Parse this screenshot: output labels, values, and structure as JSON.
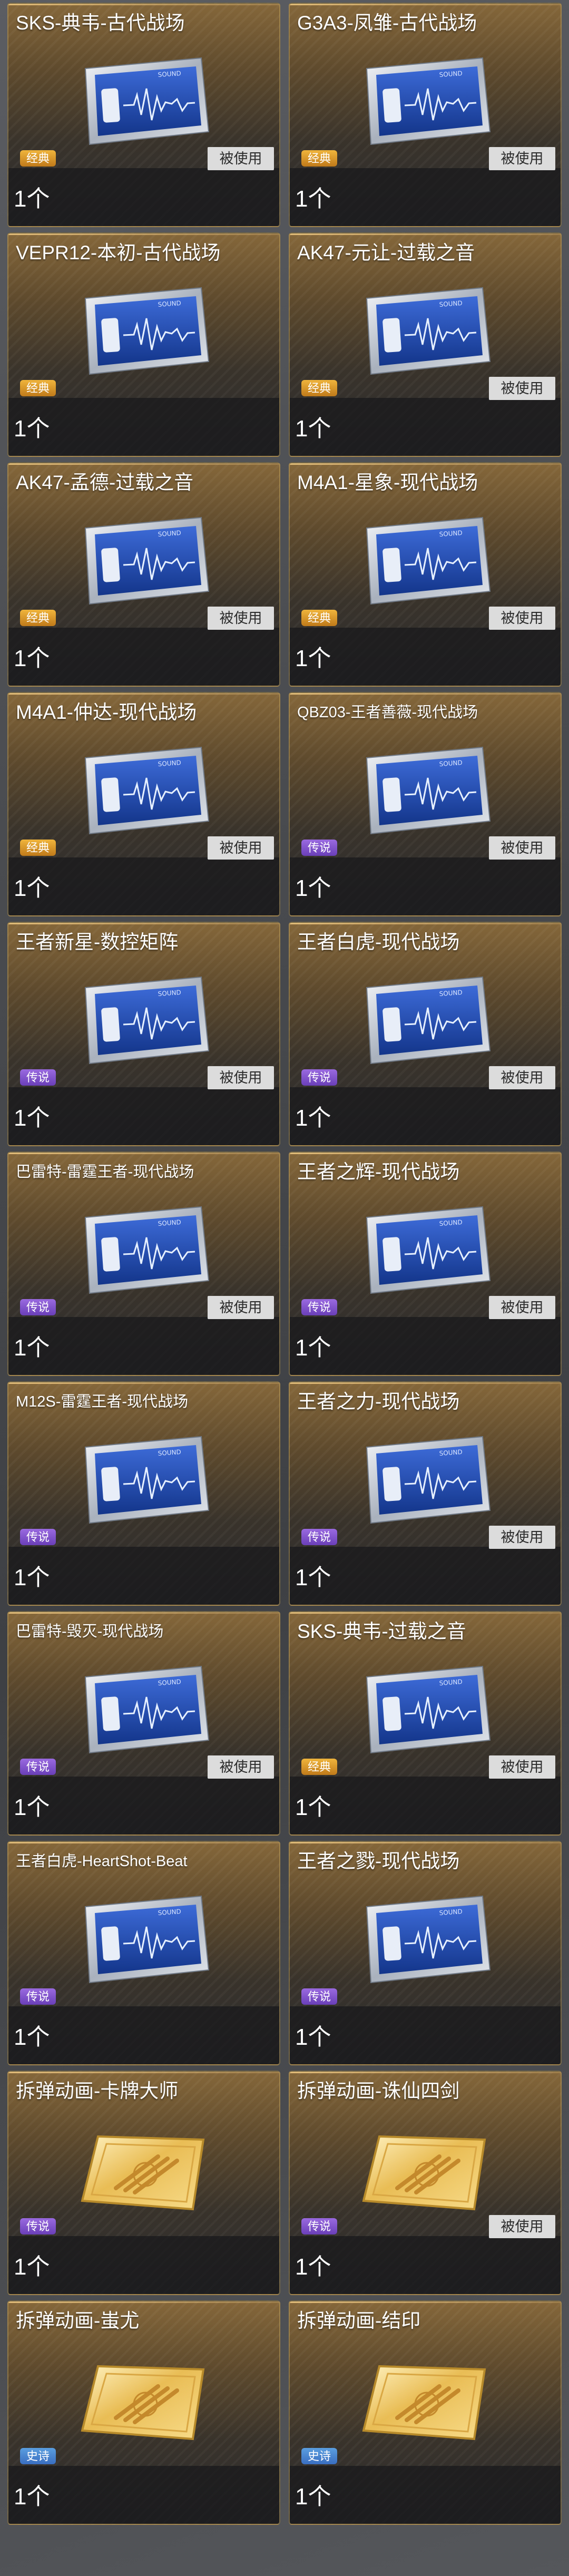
{
  "items": [
    {
      "name": "SKS-典韦-古代战场",
      "rarity": "经典",
      "rarity_class": "gold",
      "used": true,
      "quantity": "1个",
      "icon": "sound-card"
    },
    {
      "name": "G3A3-凤雏-古代战场",
      "rarity": "经典",
      "rarity_class": "gold",
      "used": true,
      "quantity": "1个",
      "icon": "sound-card"
    },
    {
      "name": "VEPR12-本初-古代战场",
      "rarity": "经典",
      "rarity_class": "gold",
      "used": false,
      "quantity": "1个",
      "icon": "sound-card"
    },
    {
      "name": "AK47-元让-过载之音",
      "rarity": "经典",
      "rarity_class": "gold",
      "used": true,
      "quantity": "1个",
      "icon": "sound-card"
    },
    {
      "name": "AK47-孟德-过载之音",
      "rarity": "经典",
      "rarity_class": "gold",
      "used": true,
      "quantity": "1个",
      "icon": "sound-card"
    },
    {
      "name": "M4A1-星象-现代战场",
      "rarity": "经典",
      "rarity_class": "gold",
      "used": true,
      "quantity": "1个",
      "icon": "sound-card"
    },
    {
      "name": "M4A1-仲达-现代战场",
      "rarity": "经典",
      "rarity_class": "gold",
      "used": true,
      "quantity": "1个",
      "icon": "sound-card"
    },
    {
      "name": "QBZ03-王者善薇-现代战场",
      "rarity": "传说",
      "rarity_class": "purple",
      "used": true,
      "quantity": "1个",
      "icon": "sound-card",
      "small": true
    },
    {
      "name": "王者新星-数控矩阵",
      "rarity": "传说",
      "rarity_class": "purple",
      "used": true,
      "quantity": "1个",
      "icon": "sound-card"
    },
    {
      "name": "王者白虎-现代战场",
      "rarity": "传说",
      "rarity_class": "purple",
      "used": true,
      "quantity": "1个",
      "icon": "sound-card"
    },
    {
      "name": "巴雷特-雷霆王者-现代战场",
      "rarity": "传说",
      "rarity_class": "purple",
      "used": true,
      "quantity": "1个",
      "icon": "sound-card",
      "small": true
    },
    {
      "name": "王者之辉-现代战场",
      "rarity": "传说",
      "rarity_class": "purple",
      "used": true,
      "quantity": "1个",
      "icon": "sound-card"
    },
    {
      "name": "M12S-雷霆王者-现代战场",
      "rarity": "传说",
      "rarity_class": "purple",
      "used": false,
      "quantity": "1个",
      "icon": "sound-card",
      "small": true
    },
    {
      "name": "王者之力-现代战场",
      "rarity": "传说",
      "rarity_class": "purple",
      "used": true,
      "quantity": "1个",
      "icon": "sound-card"
    },
    {
      "name": "巴雷特-毁灭-现代战场",
      "rarity": "传说",
      "rarity_class": "purple",
      "used": true,
      "quantity": "1个",
      "icon": "sound-card",
      "small": true
    },
    {
      "name": "SKS-典韦-过载之音",
      "rarity": "经典",
      "rarity_class": "gold",
      "used": true,
      "quantity": "1个",
      "icon": "sound-card"
    },
    {
      "name": "王者白虎-HeartShot-Beat",
      "rarity": "传说",
      "rarity_class": "purple",
      "used": false,
      "quantity": "1个",
      "icon": "sound-card",
      "small": true
    },
    {
      "name": "王者之戮-现代战场",
      "rarity": "传说",
      "rarity_class": "purple",
      "used": false,
      "quantity": "1个",
      "icon": "sound-card"
    },
    {
      "name": "拆弹动画-卡牌大师",
      "rarity": "传说",
      "rarity_class": "purple",
      "used": false,
      "quantity": "1个",
      "icon": "gold-card"
    },
    {
      "name": "拆弹动画-诛仙四剑",
      "rarity": "传说",
      "rarity_class": "purple",
      "used": true,
      "quantity": "1个",
      "icon": "gold-card"
    },
    {
      "name": "拆弹动画-蚩尤",
      "rarity": "史诗",
      "rarity_class": "blue",
      "used": false,
      "quantity": "1个",
      "icon": "gold-card"
    },
    {
      "name": "拆弹动画-结印",
      "rarity": "史诗",
      "rarity_class": "blue",
      "used": false,
      "quantity": "1个",
      "icon": "gold-card"
    }
  ],
  "used_label": "被使用",
  "sound_label": "SOUND",
  "colors": {
    "accent_gold": "#c8a466",
    "rarity_gold": "#e3a234",
    "rarity_purple": "#8a5cd8",
    "rarity_blue": "#4a8ad8"
  }
}
